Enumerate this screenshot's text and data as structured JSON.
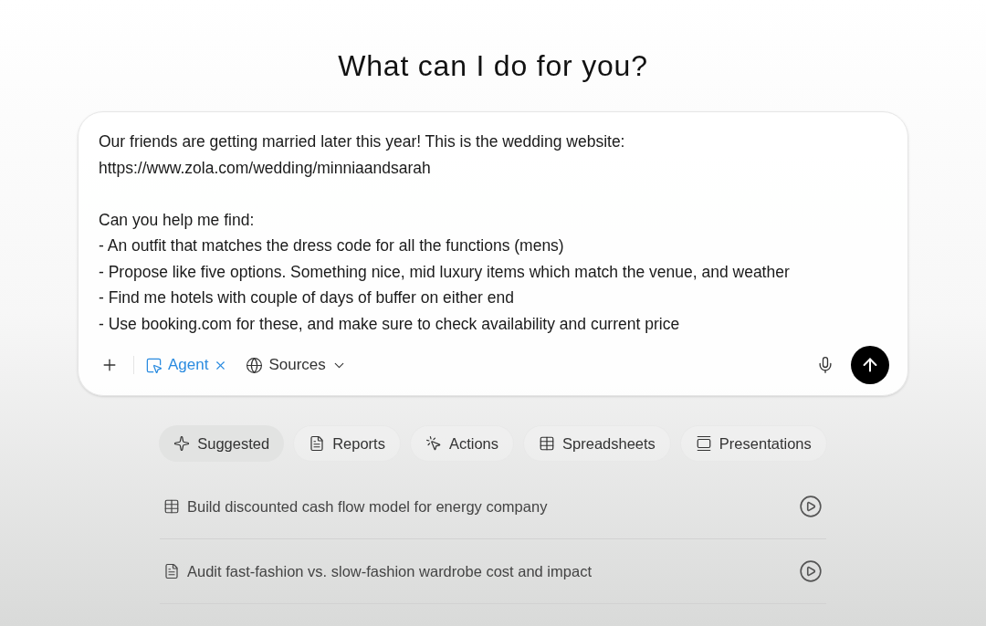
{
  "heading": "What can I do for you?",
  "composer": {
    "value": "Our friends are getting married later this year! This is the wedding website:\nhttps://www.zola.com/wedding/minniaandsarah\n\nCan you help me find:\n- An outfit that matches the dress code for all the functions (mens)\n- Propose like five options. Something nice, mid luxury items which match the venue, and weather\n- Find me hotels with couple of days of buffer on either end\n- Use booking.com for these, and make sure to check availability and current price",
    "mode_chip": {
      "label": "Agent",
      "active": true
    },
    "sources_label": "Sources"
  },
  "tabs": [
    {
      "label": "Suggested",
      "kind": "sparkle",
      "selected": true
    },
    {
      "label": "Reports",
      "kind": "report",
      "selected": false
    },
    {
      "label": "Actions",
      "kind": "action",
      "selected": false
    },
    {
      "label": "Spreadsheets",
      "kind": "table",
      "selected": false
    },
    {
      "label": "Presentations",
      "kind": "slides",
      "selected": false
    }
  ],
  "suggestions": [
    {
      "text": "Build discounted cash flow model for energy company",
      "kind": "table"
    },
    {
      "text": "Audit fast-fashion vs. slow-fashion wardrobe cost and impact",
      "kind": "report"
    }
  ]
}
